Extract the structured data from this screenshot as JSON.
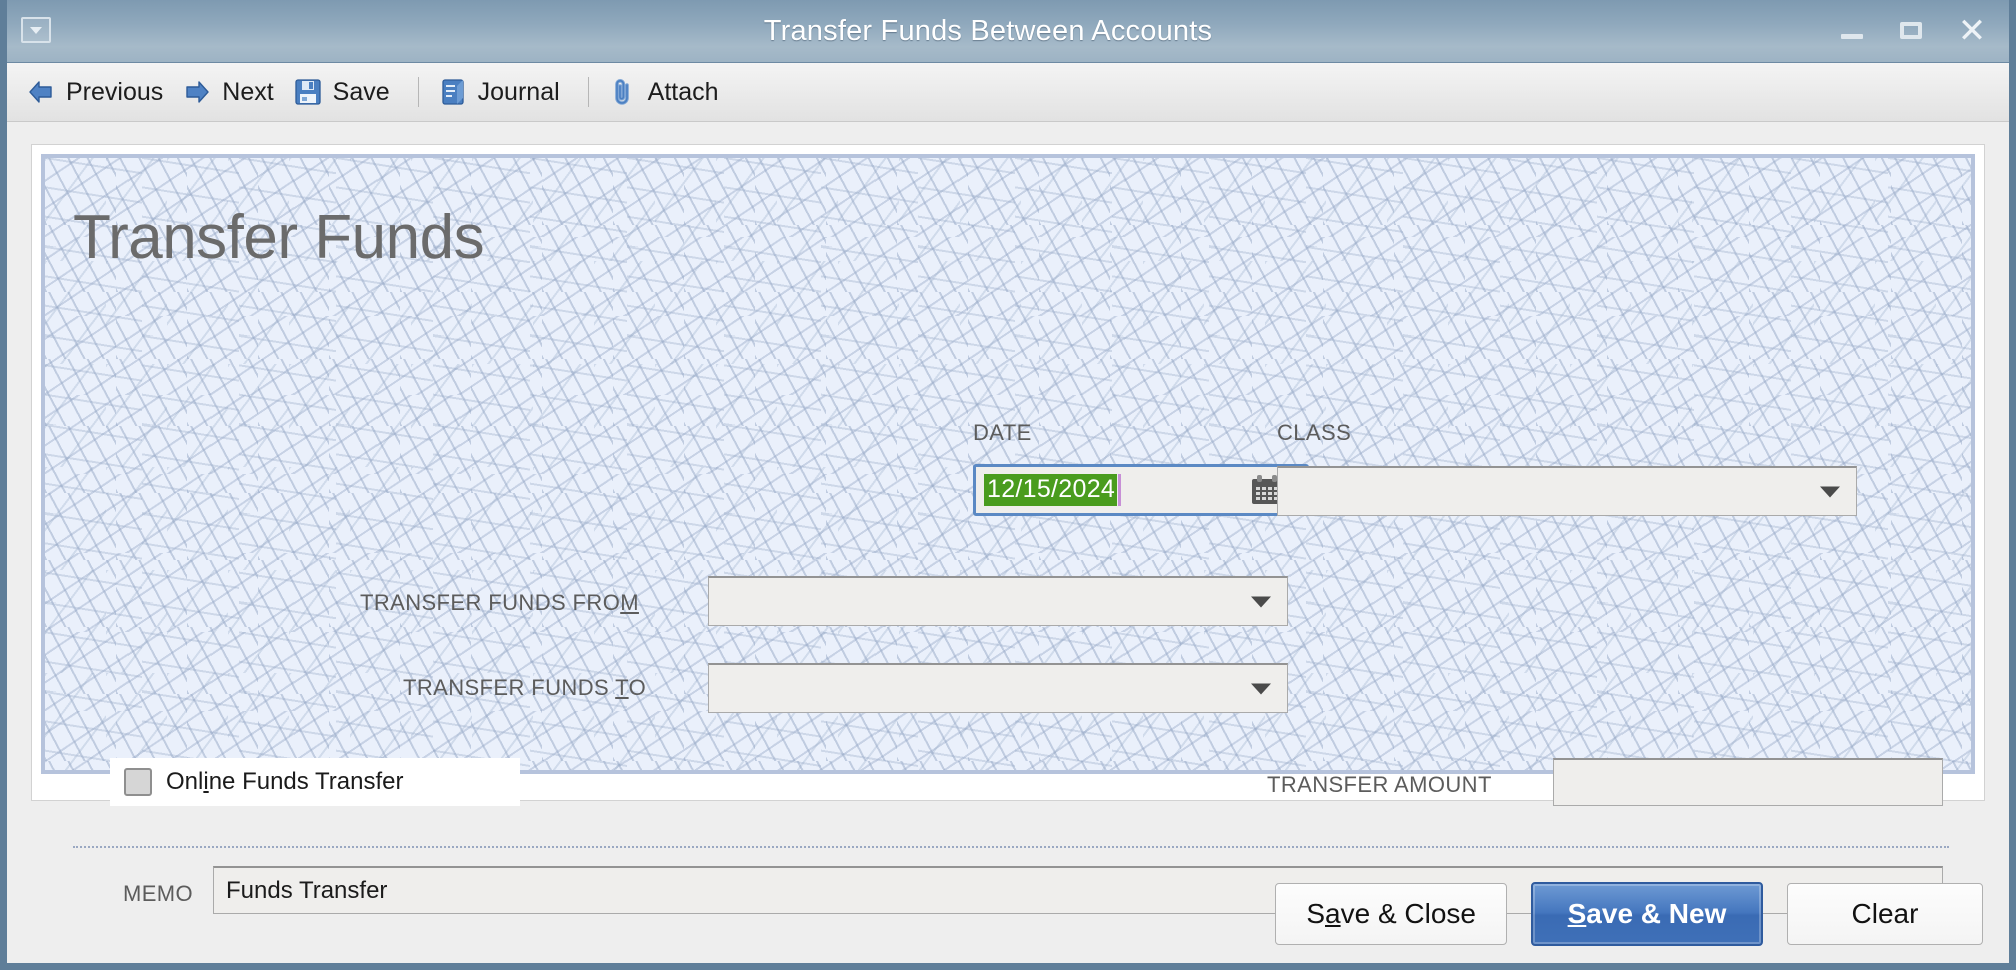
{
  "window": {
    "title": "Transfer Funds Between Accounts",
    "sysmenu_icon": "window-menu-icon",
    "minimize_label": "",
    "maximize_label": "",
    "close_label": "✕"
  },
  "toolbar": {
    "items": [
      {
        "label": "Previous",
        "icon": "arrow-left-icon"
      },
      {
        "label": "Next",
        "icon": "arrow-right-icon"
      },
      {
        "label": "Save",
        "icon": "floppy-disk-icon"
      },
      {
        "label": "Journal",
        "icon": "journal-book-icon"
      },
      {
        "label": "Attach",
        "icon": "paperclip-icon"
      }
    ]
  },
  "form": {
    "heading": "Transfer Funds",
    "date": {
      "label": "DATE",
      "value": "12/15/2024",
      "selected": true,
      "icon": "calendar-icon"
    },
    "class": {
      "label": "CLASS",
      "value": "",
      "placeholder": ""
    },
    "transfer_from": {
      "label_pre": "TRANSFER FUNDS FRO",
      "label_accel": "M",
      "label_post": "",
      "value": ""
    },
    "transfer_to": {
      "label_pre": "TRANSFER FUNDS ",
      "label_accel": "T",
      "label_post": "O",
      "value": ""
    },
    "online_funds_transfer": {
      "label_pre": "Onl",
      "label_accel": "i",
      "label_post": "ne Funds Transfer",
      "checked": false
    },
    "transfer_amount": {
      "label": "TRANSFER AMOUNT",
      "value": ""
    },
    "memo": {
      "label": "MEMO",
      "value": "Funds Transfer"
    }
  },
  "footer": {
    "save_close": {
      "pre": "S",
      "accel": "a",
      "post": "ve & Close"
    },
    "save_new": {
      "pre": "",
      "accel": "S",
      "post": "ave & New"
    },
    "clear": "Clear"
  },
  "colors": {
    "titlebar": "#90a9bd",
    "primary_button": "#3f70b8",
    "date_selection": "#4a9c1e",
    "form_background": "#eaf0fb",
    "form_border": "#b6c3dc"
  }
}
